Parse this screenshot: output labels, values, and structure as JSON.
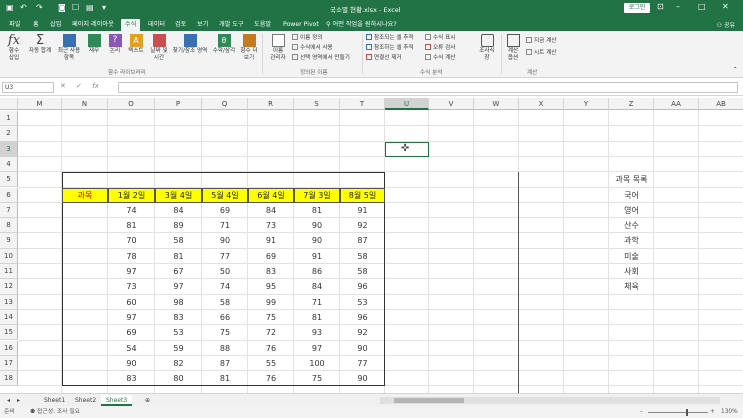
{
  "titlebar": {
    "title": "국소별 현황.xlsx  -  Excel",
    "login_label": "로그인",
    "icons": [
      "save-icon",
      "undo-icon",
      "redo-icon",
      "camera-icon",
      "touch-mode-icon",
      "print-preview-icon",
      "customize-icon"
    ]
  },
  "tabs": [
    "파일",
    "홈",
    "삽입",
    "페이지 레이아웃",
    "수식",
    "데이터",
    "검토",
    "보기",
    "개발 도구",
    "도움말",
    "Power Pivot"
  ],
  "active_tab": "수식",
  "tell_me": "어떤 작업을 원하시나요?",
  "share_label": "공유",
  "ribbon": {
    "insert_function": [
      "함수",
      "삽입"
    ],
    "autosum": "자동 합계",
    "recent": [
      "최근 사용",
      "항목"
    ],
    "financial": "재무",
    "logical": "논리",
    "text": "텍스트",
    "datetime": [
      "날짜 및",
      "시간"
    ],
    "lookup": "찾기/참조 영역",
    "math": "수학/삼각",
    "more": [
      "함수 더",
      "보기"
    ],
    "name_manager": [
      "이름",
      "관리자"
    ],
    "define_name": "이름 정의",
    "use_in_formula": "수식에서 사용",
    "create_from_selection": "선택 영역에서 만들기",
    "trace_precedents": "참조되는 셀 추적",
    "trace_dependents": "참조하는 셀 추적",
    "remove_arrows": "연결선 제거",
    "show_formulas": "수식 표시",
    "error_checking": "오류 검사",
    "evaluate_formula": "수식 계산",
    "watch_window": [
      "조사식",
      "창"
    ],
    "calc_options": [
      "계산",
      "옵션"
    ],
    "calc_now": "지금 계산",
    "calc_sheet": "시트 계산",
    "groups": {
      "function_library": "함수 라이브러리",
      "defined_names": "정의된 이름",
      "formula_auditing": "수식 분석",
      "calculation": "계산"
    }
  },
  "formula_bar": {
    "name_box": "U3",
    "cancel": "✕",
    "enter": "✓",
    "fx": "fx",
    "value": ""
  },
  "columns": [
    "M",
    "N",
    "O",
    "P",
    "Q",
    "R",
    "S",
    "T",
    "U",
    "V",
    "W",
    "X",
    "Y",
    "Z",
    "AA",
    "AB"
  ],
  "selected_column": "U",
  "rows": [
    "1",
    "2",
    "3",
    "4",
    "5",
    "6",
    "7",
    "8",
    "9",
    "10",
    "11",
    "12",
    "13",
    "14",
    "15",
    "16",
    "17",
    "18"
  ],
  "selected_row": "3",
  "table": {
    "header": [
      "과목",
      "1월 2일",
      "3월 4일",
      "5월 4일",
      "6월 4일",
      "7월 3일",
      "8월 5일"
    ],
    "rows": [
      [
        74,
        84,
        69,
        84,
        81,
        91
      ],
      [
        81,
        89,
        71,
        73,
        90,
        92
      ],
      [
        70,
        58,
        90,
        91,
        90,
        87
      ],
      [
        78,
        81,
        77,
        69,
        91,
        58
      ],
      [
        97,
        67,
        50,
        83,
        86,
        58
      ],
      [
        73,
        97,
        74,
        95,
        84,
        96
      ],
      [
        60,
        98,
        58,
        99,
        71,
        53
      ],
      [
        97,
        83,
        66,
        75,
        81,
        96
      ],
      [
        69,
        53,
        75,
        72,
        93,
        92
      ],
      [
        54,
        59,
        88,
        76,
        97,
        90
      ],
      [
        90,
        82,
        87,
        55,
        100,
        77
      ],
      [
        83,
        80,
        81,
        76,
        75,
        90
      ]
    ]
  },
  "subject_list": {
    "title": "과목 목록",
    "items": [
      "국어",
      "영어",
      "산수",
      "과학",
      "미술",
      "사회",
      "체육"
    ]
  },
  "colors": {
    "excel_green": "#217346",
    "header_fill": "#ffff00",
    "header_text_red": "#d00000"
  },
  "sheets": [
    "Sheet1",
    "Sheet2",
    "Sheet3"
  ],
  "active_sheet": "Sheet3",
  "status": {
    "ready": "준비",
    "accessibility": "접근성: 조사 필요",
    "zoom": "130%"
  }
}
